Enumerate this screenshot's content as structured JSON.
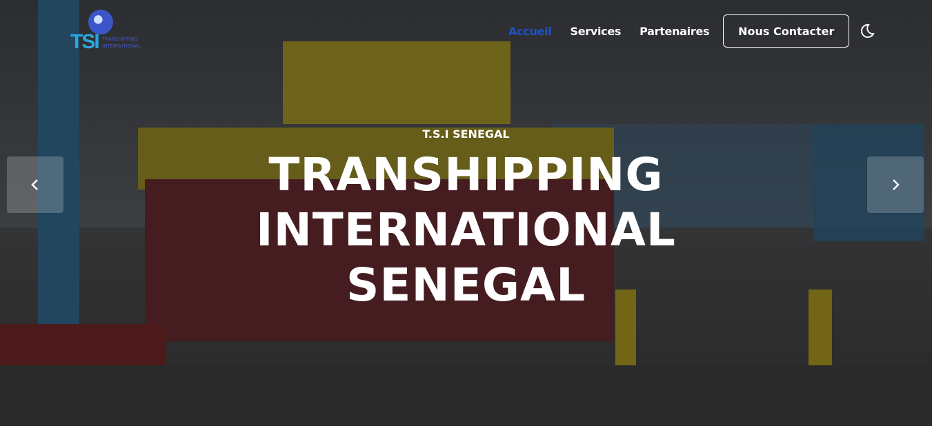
{
  "logo": {
    "mark": "TSI",
    "tagline_line1": "TRANSHIPPING",
    "tagline_line2": "INTERNATIONAL"
  },
  "nav": {
    "items": [
      {
        "label": "Accueil",
        "active": true
      },
      {
        "label": "Services",
        "active": false
      },
      {
        "label": "Partenaires",
        "active": false
      }
    ],
    "contact_label": "Nous Contacter",
    "theme_icon": "moon-icon"
  },
  "hero": {
    "kicker": "T.S.I SENEGAL",
    "title_line1": "TRANSHIPPING",
    "title_line2": "INTERNATIONAL",
    "title_line3": "SENEGAL"
  },
  "carousel": {
    "prev_icon": "chevron-left-icon",
    "next_icon": "chevron-right-icon"
  },
  "colors": {
    "accent": "#1f52c9",
    "logo_blue": "#2aa6e0"
  }
}
